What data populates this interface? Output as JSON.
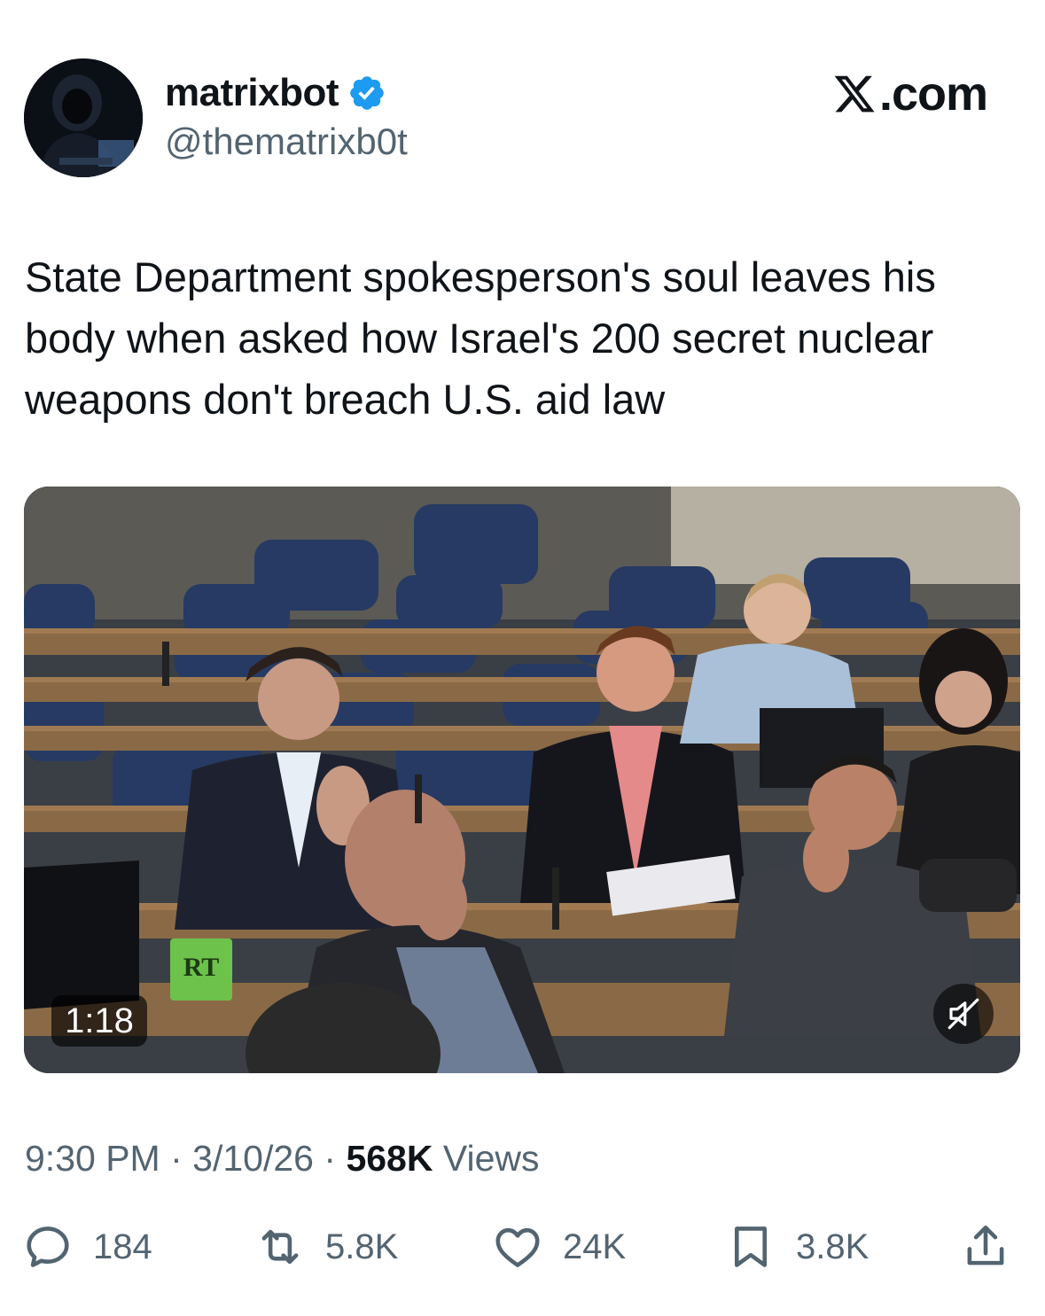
{
  "author": {
    "display_name": "matrixbot",
    "handle": "@thematrixb0t",
    "verified": true,
    "avatar_icon": "hooded-hacker-avatar"
  },
  "brand": {
    "logo_icon": "x-logo-icon",
    "text": ".com"
  },
  "tweet": {
    "text": "State Department spokesperson's soul leaves his body when asked how Israel's 200 secret nuclear weapons don't breach U.S. aid law"
  },
  "video": {
    "duration": "1:18",
    "watermark": "RT",
    "muted": true
  },
  "meta": {
    "time": "9:30 PM",
    "sep1": "·",
    "date": "3/10/26",
    "sep2": "·",
    "views_count": "568K",
    "views_label": "Views"
  },
  "actions": {
    "replies": "184",
    "reposts": "5.8K",
    "likes": "24K",
    "bookmarks": "3.8K"
  },
  "colors": {
    "text_primary": "#0f1419",
    "text_secondary": "#536471",
    "verified_blue": "#1d9bf0"
  }
}
